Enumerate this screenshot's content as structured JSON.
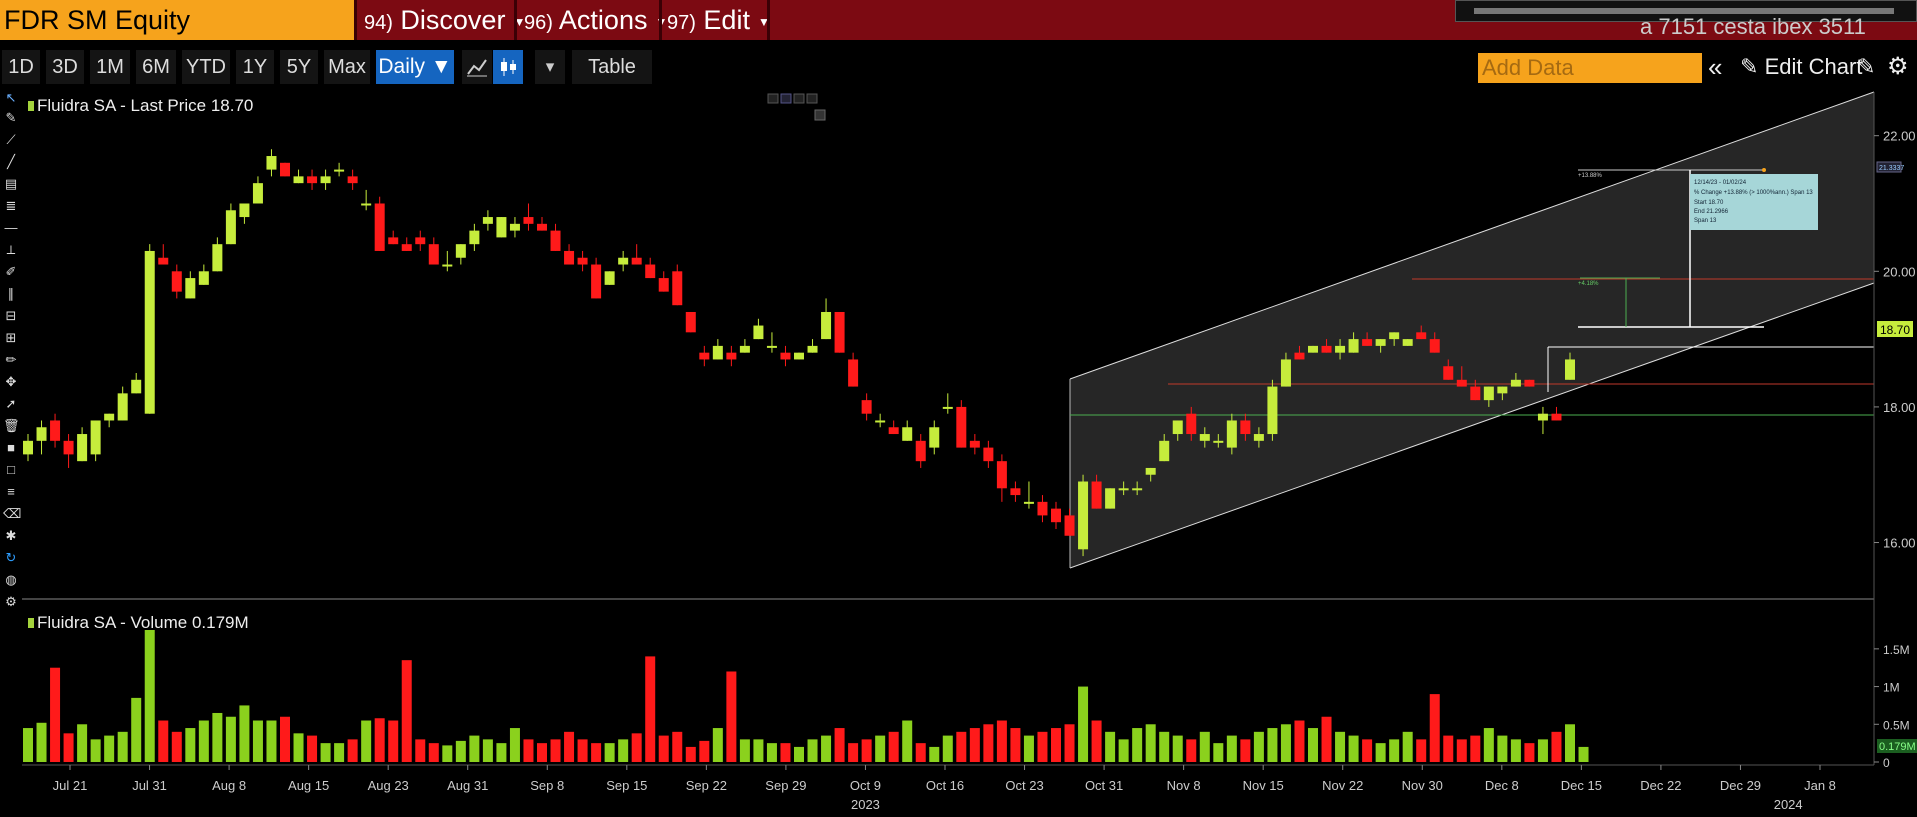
{
  "app": {
    "ticker": "FDR SM Equity",
    "menus": [
      {
        "num": "94)",
        "label": "Discover"
      },
      {
        "num": "96)",
        "label": "Actions"
      },
      {
        "num": "97)",
        "label": "Edit"
      }
    ],
    "ghost_text": "a 7151 cesta ibex 3511"
  },
  "toolbar": {
    "periods": [
      "1D",
      "3D",
      "1M",
      "6M",
      "YTD",
      "1Y",
      "5Y",
      "Max"
    ],
    "frequency": "Daily ▼",
    "table_label": "Table",
    "add_data_placeholder": "Add Data",
    "edit_chart_label": "Edit Chart",
    "collapse_label": "«"
  },
  "colors": {
    "up": "#c6ec3c",
    "down": "#ff1a1a",
    "volume_up": "#8bd11d",
    "volume_down": "#ff1a1a",
    "accent": "#f6a31c",
    "title_bar": "#7c0a12"
  },
  "price_panel": {
    "legend": "Fluidra SA - Last Price 18.70",
    "last_price_tag": "18.70",
    "y_ticks": [
      16.0,
      18.0,
      20.0,
      22.0
    ],
    "y_tick_labels": [
      "16.00",
      "18.00",
      "20.00",
      "22.00"
    ]
  },
  "volume_panel": {
    "legend": "Fluidra SA - Volume 0.179M",
    "y_tick_labels": [
      "0",
      "0.5M",
      "1M",
      "1.5M"
    ],
    "y_ticks": [
      0,
      0.5,
      1.0,
      1.5
    ],
    "last_volume_tag": "0.179M"
  },
  "x_axis": {
    "labels": [
      "Jul 21",
      "Jul 31",
      "Aug 8",
      "Aug 15",
      "Aug 23",
      "Aug 31",
      "Sep 8",
      "Sep 15",
      "Sep 22",
      "Sep 29",
      "Oct 9",
      "Oct 16",
      "Oct 23",
      "Oct 31",
      "Nov 8",
      "Nov 15",
      "Nov 22",
      "Nov 30",
      "Dec 8",
      "Dec 15",
      "Dec 22",
      "Dec 29",
      "Jan 8"
    ],
    "years": [
      "2023",
      "2024"
    ]
  },
  "annotation": {
    "pct_left": "+13.88%",
    "pct_small": "+4.18%",
    "right_tag": "21.3337",
    "info_lines": [
      "12/14/23 - 01/02/24",
      "% Change +13.88% (> 1000%ann.) Span 13",
      "Start 18.70",
      "End 21.2966",
      "Span 13"
    ]
  },
  "chart_data": {
    "type": "candlestick",
    "y_range": [
      15.3,
      22.6
    ],
    "volume_range": [
      0,
      1.75
    ],
    "candles": [
      [
        17.3,
        17.6,
        17.2,
        17.5
      ],
      [
        17.5,
        17.8,
        17.3,
        17.7
      ],
      [
        17.8,
        17.9,
        17.4,
        17.5
      ],
      [
        17.5,
        17.6,
        17.1,
        17.3
      ],
      [
        17.2,
        17.7,
        17.2,
        17.6
      ],
      [
        17.3,
        17.8,
        17.2,
        17.8
      ],
      [
        17.8,
        17.9,
        17.7,
        17.9
      ],
      [
        17.8,
        18.3,
        17.8,
        18.2
      ],
      [
        18.2,
        18.5,
        18.2,
        18.4
      ],
      [
        17.9,
        20.4,
        17.9,
        20.3
      ],
      [
        20.2,
        20.4,
        20.1,
        20.1
      ],
      [
        20.0,
        20.1,
        19.6,
        19.7
      ],
      [
        19.6,
        20.0,
        19.6,
        19.9
      ],
      [
        19.8,
        20.1,
        19.8,
        20.0
      ],
      [
        20.0,
        20.5,
        20.0,
        20.4
      ],
      [
        20.4,
        21.0,
        20.4,
        20.9
      ],
      [
        20.8,
        21.0,
        20.7,
        21.0
      ],
      [
        21.0,
        21.4,
        21.0,
        21.3
      ],
      [
        21.5,
        21.8,
        21.4,
        21.7
      ],
      [
        21.6,
        21.6,
        21.4,
        21.4
      ],
      [
        21.3,
        21.5,
        21.3,
        21.4
      ],
      [
        21.4,
        21.5,
        21.2,
        21.3
      ],
      [
        21.3,
        21.5,
        21.2,
        21.4
      ],
      [
        21.5,
        21.6,
        21.4,
        21.5
      ],
      [
        21.4,
        21.5,
        21.2,
        21.3
      ],
      [
        21.0,
        21.2,
        20.9,
        21.0
      ],
      [
        21.0,
        21.1,
        20.3,
        20.3
      ],
      [
        20.5,
        20.6,
        20.4,
        20.4
      ],
      [
        20.4,
        20.5,
        20.3,
        20.3
      ],
      [
        20.5,
        20.6,
        20.3,
        20.4
      ],
      [
        20.4,
        20.5,
        20.1,
        20.1
      ],
      [
        20.1,
        20.3,
        20.0,
        20.1
      ],
      [
        20.2,
        20.4,
        20.1,
        20.4
      ],
      [
        20.4,
        20.7,
        20.3,
        20.6
      ],
      [
        20.7,
        20.9,
        20.6,
        20.8
      ],
      [
        20.5,
        20.8,
        20.5,
        20.8
      ],
      [
        20.6,
        20.8,
        20.5,
        20.7
      ],
      [
        20.8,
        21.0,
        20.6,
        20.7
      ],
      [
        20.7,
        20.8,
        20.6,
        20.6
      ],
      [
        20.6,
        20.7,
        20.3,
        20.3
      ],
      [
        20.3,
        20.4,
        20.1,
        20.1
      ],
      [
        20.2,
        20.3,
        20.0,
        20.1
      ],
      [
        20.1,
        20.2,
        19.6,
        19.6
      ],
      [
        19.8,
        20.0,
        19.8,
        20.0
      ],
      [
        20.1,
        20.3,
        20.0,
        20.2
      ],
      [
        20.2,
        20.4,
        20.1,
        20.1
      ],
      [
        20.1,
        20.2,
        19.9,
        19.9
      ],
      [
        19.9,
        20.0,
        19.7,
        19.7
      ],
      [
        20.0,
        20.1,
        19.5,
        19.5
      ],
      [
        19.4,
        19.4,
        19.1,
        19.1
      ],
      [
        18.8,
        18.9,
        18.6,
        18.7
      ],
      [
        18.7,
        19.0,
        18.7,
        18.9
      ],
      [
        18.8,
        18.9,
        18.6,
        18.7
      ],
      [
        18.8,
        19.0,
        18.8,
        18.9
      ],
      [
        19.0,
        19.3,
        19.0,
        19.2
      ],
      [
        18.9,
        19.1,
        18.8,
        18.9
      ],
      [
        18.8,
        18.9,
        18.6,
        18.7
      ],
      [
        18.7,
        18.8,
        18.7,
        18.8
      ],
      [
        18.8,
        19.0,
        18.8,
        18.9
      ],
      [
        19.0,
        19.6,
        19.0,
        19.4
      ],
      [
        19.4,
        19.4,
        18.8,
        18.8
      ],
      [
        18.7,
        18.8,
        18.3,
        18.3
      ],
      [
        18.1,
        18.2,
        17.8,
        17.9
      ],
      [
        17.8,
        17.9,
        17.7,
        17.8
      ],
      [
        17.7,
        17.8,
        17.6,
        17.6
      ],
      [
        17.5,
        17.8,
        17.5,
        17.7
      ],
      [
        17.5,
        17.6,
        17.1,
        17.2
      ],
      [
        17.4,
        17.8,
        17.3,
        17.7
      ],
      [
        18.0,
        18.2,
        17.9,
        18.0
      ],
      [
        18.0,
        18.1,
        17.4,
        17.4
      ],
      [
        17.5,
        17.6,
        17.3,
        17.4
      ],
      [
        17.4,
        17.5,
        17.1,
        17.2
      ],
      [
        17.2,
        17.3,
        16.6,
        16.8
      ],
      [
        16.8,
        16.9,
        16.6,
        16.7
      ],
      [
        16.6,
        16.9,
        16.5,
        16.6
      ],
      [
        16.6,
        16.7,
        16.3,
        16.4
      ],
      [
        16.5,
        16.6,
        16.2,
        16.3
      ],
      [
        16.4,
        16.5,
        16.1,
        16.1
      ],
      [
        15.9,
        17.0,
        15.8,
        16.9
      ],
      [
        16.9,
        17.0,
        16.5,
        16.5
      ],
      [
        16.5,
        16.8,
        16.5,
        16.8
      ],
      [
        16.8,
        16.9,
        16.7,
        16.8
      ],
      [
        16.8,
        16.9,
        16.7,
        16.8
      ],
      [
        17.0,
        17.1,
        16.9,
        17.1
      ],
      [
        17.2,
        17.6,
        17.2,
        17.5
      ],
      [
        17.6,
        17.8,
        17.5,
        17.8
      ],
      [
        17.9,
        18.0,
        17.5,
        17.6
      ],
      [
        17.5,
        17.7,
        17.4,
        17.6
      ],
      [
        17.5,
        17.6,
        17.4,
        17.5
      ],
      [
        17.4,
        17.9,
        17.3,
        17.8
      ],
      [
        17.8,
        17.9,
        17.5,
        17.6
      ],
      [
        17.5,
        17.7,
        17.4,
        17.6
      ],
      [
        17.6,
        18.4,
        17.5,
        18.3
      ],
      [
        18.3,
        18.8,
        18.3,
        18.7
      ],
      [
        18.8,
        18.9,
        18.7,
        18.7
      ],
      [
        18.8,
        18.9,
        18.8,
        18.9
      ],
      [
        18.9,
        19.0,
        18.8,
        18.8
      ],
      [
        18.8,
        19.0,
        18.7,
        18.9
      ],
      [
        18.8,
        19.1,
        18.8,
        19.0
      ],
      [
        19.0,
        19.1,
        18.9,
        18.9
      ],
      [
        18.9,
        19.0,
        18.8,
        19.0
      ],
      [
        19.0,
        19.1,
        18.9,
        19.1
      ],
      [
        18.9,
        19.0,
        18.9,
        19.0
      ],
      [
        19.1,
        19.2,
        19.0,
        19.0
      ],
      [
        19.0,
        19.1,
        18.8,
        18.8
      ],
      [
        18.6,
        18.7,
        18.4,
        18.4
      ],
      [
        18.4,
        18.6,
        18.3,
        18.3
      ],
      [
        18.3,
        18.4,
        18.1,
        18.1
      ],
      [
        18.1,
        18.3,
        18.0,
        18.3
      ],
      [
        18.2,
        18.3,
        18.1,
        18.3
      ],
      [
        18.3,
        18.5,
        18.3,
        18.4
      ],
      [
        18.4,
        18.4,
        18.3,
        18.3
      ],
      [
        17.8,
        18.0,
        17.6,
        17.9
      ],
      [
        17.9,
        18.0,
        17.8,
        17.8
      ],
      [
        18.4,
        18.8,
        18.4,
        18.7
      ]
    ],
    "volumes": [
      0.45,
      0.52,
      1.25,
      0.38,
      0.5,
      0.3,
      0.35,
      0.4,
      0.85,
      1.75,
      0.55,
      0.4,
      0.45,
      0.55,
      0.65,
      0.6,
      0.75,
      0.55,
      0.55,
      0.6,
      0.38,
      0.35,
      0.25,
      0.25,
      0.3,
      0.55,
      0.58,
      0.55,
      1.35,
      0.3,
      0.25,
      0.22,
      0.28,
      0.35,
      0.3,
      0.25,
      0.45,
      0.3,
      0.25,
      0.3,
      0.4,
      0.3,
      0.25,
      0.25,
      0.3,
      0.38,
      1.4,
      0.35,
      0.4,
      0.2,
      0.28,
      0.45,
      1.2,
      0.3,
      0.3,
      0.25,
      0.25,
      0.2,
      0.3,
      0.35,
      0.45,
      0.25,
      0.3,
      0.35,
      0.4,
      0.55,
      0.25,
      0.2,
      0.35,
      0.4,
      0.45,
      0.5,
      0.55,
      0.45,
      0.35,
      0.4,
      0.45,
      0.5,
      1.0,
      0.55,
      0.4,
      0.3,
      0.45,
      0.5,
      0.4,
      0.35,
      0.3,
      0.4,
      0.25,
      0.35,
      0.3,
      0.4,
      0.45,
      0.5,
      0.55,
      0.45,
      0.6,
      0.4,
      0.35,
      0.3,
      0.25,
      0.3,
      0.4,
      0.3,
      0.9,
      0.35,
      0.3,
      0.35,
      0.45,
      0.35,
      0.3,
      0.25,
      0.3,
      0.4,
      0.5,
      0.2
    ]
  }
}
